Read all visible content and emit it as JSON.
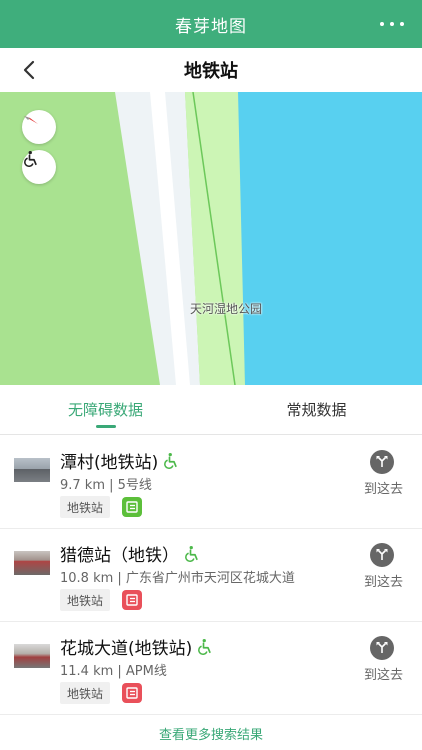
{
  "app": {
    "title": "春芽地图"
  },
  "nav": {
    "title": "地铁站"
  },
  "map": {
    "label": "天河湿地公园"
  },
  "tabs": [
    {
      "label": "无障碍数据",
      "active": true
    },
    {
      "label": "常规数据",
      "active": false
    }
  ],
  "results": [
    {
      "name": "潭村(地铁站)",
      "meta": "9.7 km | 5号线",
      "tag": "地铁站",
      "badge_color": "#5cbf3a",
      "route_label": "到这去"
    },
    {
      "name": "猎德站（地铁）",
      "meta": "10.8 km | 广东省广州市天河区花城大道",
      "tag": "地铁站",
      "badge_color": "#e9505a",
      "route_label": "到这去"
    },
    {
      "name": "花城大道(地铁站)",
      "meta": "11.4 km | APM线",
      "tag": "地铁站",
      "badge_color": "#e9505a",
      "route_label": "到这去"
    }
  ],
  "footer": {
    "more_results": "查看更多搜索结果"
  },
  "colors": {
    "brand": "#3fae7c",
    "accent": "#3aa877",
    "water": "#58d0f0",
    "park": "#a9e290"
  },
  "icons": [
    "more-icon",
    "back-icon",
    "compass-icon",
    "wheelchair-icon",
    "route-icon",
    "exit-badge-icon"
  ]
}
